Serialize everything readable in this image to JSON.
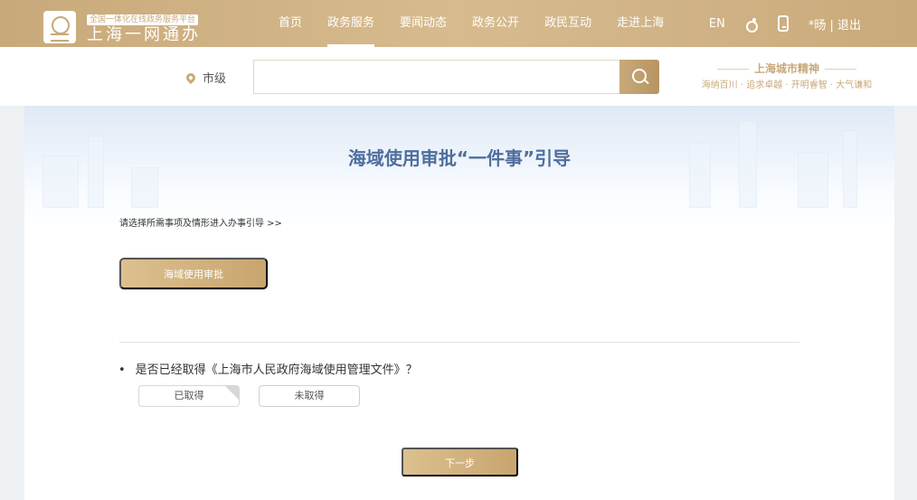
{
  "header": {
    "logo_small": "全国一体化在线政务服务平台",
    "logo_main": "上海一网通办",
    "nav": [
      "首页",
      "政务服务",
      "要闻动态",
      "政务公开",
      "政民互动",
      "走进上海"
    ],
    "active_nav": "政务服务",
    "lang": "EN",
    "user": "*旸 | 退出"
  },
  "search": {
    "location": "市级",
    "value": "",
    "spirit_title": "上海城市精神",
    "spirit_tags": "海纳百川 · 追求卓越 · 开明睿智 · 大气谦和"
  },
  "main": {
    "title": "海域使用审批“一件事”引导",
    "guide_text": "请选择所需事项及情形进入办事引导 >>",
    "matter_button": "海域使用审批",
    "question": "是否已经取得《上海市人民政府海域使用管理文件》？",
    "options": [
      "已取得",
      "未取得"
    ],
    "selected_option": "已取得",
    "next_button": "下一步"
  },
  "colors": {
    "brand_gold": "#c8a97a",
    "title_blue": "#4e6e9e"
  },
  "icons": [
    "logo-icon",
    "accessibility-icon",
    "mobile-icon",
    "location-icon",
    "search-icon"
  ]
}
